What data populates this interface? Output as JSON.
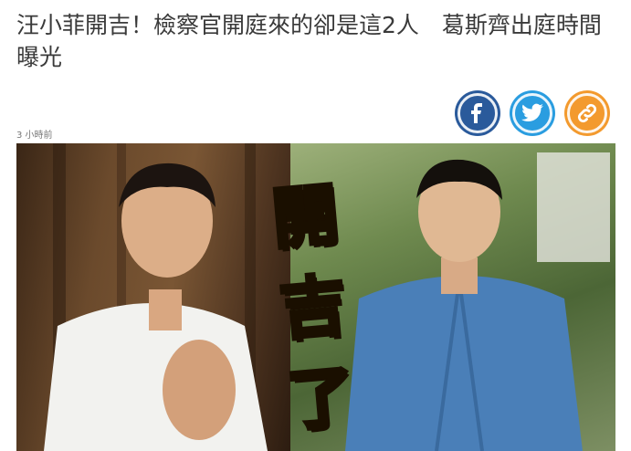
{
  "article": {
    "headline": "汪小菲開吉！檢察官開庭來的卻是這2人　葛斯齊出庭時間曝光",
    "timestamp": "3 小時前"
  },
  "share": [
    {
      "name": "facebook",
      "icon": "facebook-icon",
      "glyph": "f",
      "color": "#2a5a9b"
    },
    {
      "name": "twitter",
      "icon": "twitter-bird-icon",
      "color": "#2a9de0"
    },
    {
      "name": "copy-link",
      "icon": "link-icon",
      "color": "#f39a2e"
    }
  ],
  "photo": {
    "overlay_chars": [
      "開",
      "吉",
      "了"
    ]
  }
}
